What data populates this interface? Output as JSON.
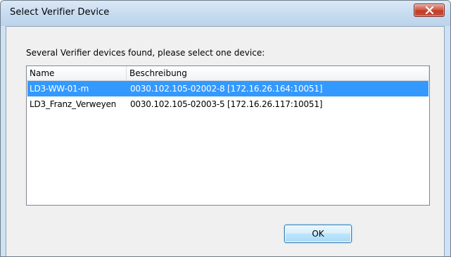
{
  "window": {
    "title": "Select Verifier Device"
  },
  "dialog": {
    "prompt": "Several Verifier devices found, please select one device:",
    "list": {
      "columns": [
        "Name",
        "Beschreibung"
      ],
      "rows": [
        {
          "name": "LD3-WW-01-m",
          "description": "0030.102.105-02002-8 [172.16.26.164:10051]",
          "selected": true
        },
        {
          "name": "LD3_Franz_Verweyen",
          "description": "0030.102.105-02003-5 [172.16.26.117:10051]",
          "selected": false
        }
      ]
    },
    "ok_label": "OK"
  },
  "colors": {
    "selection": "#3399ff",
    "close_button": "#c13c2a",
    "title_bar": "#c6dbf0"
  },
  "icons": {
    "close": "close-icon"
  }
}
